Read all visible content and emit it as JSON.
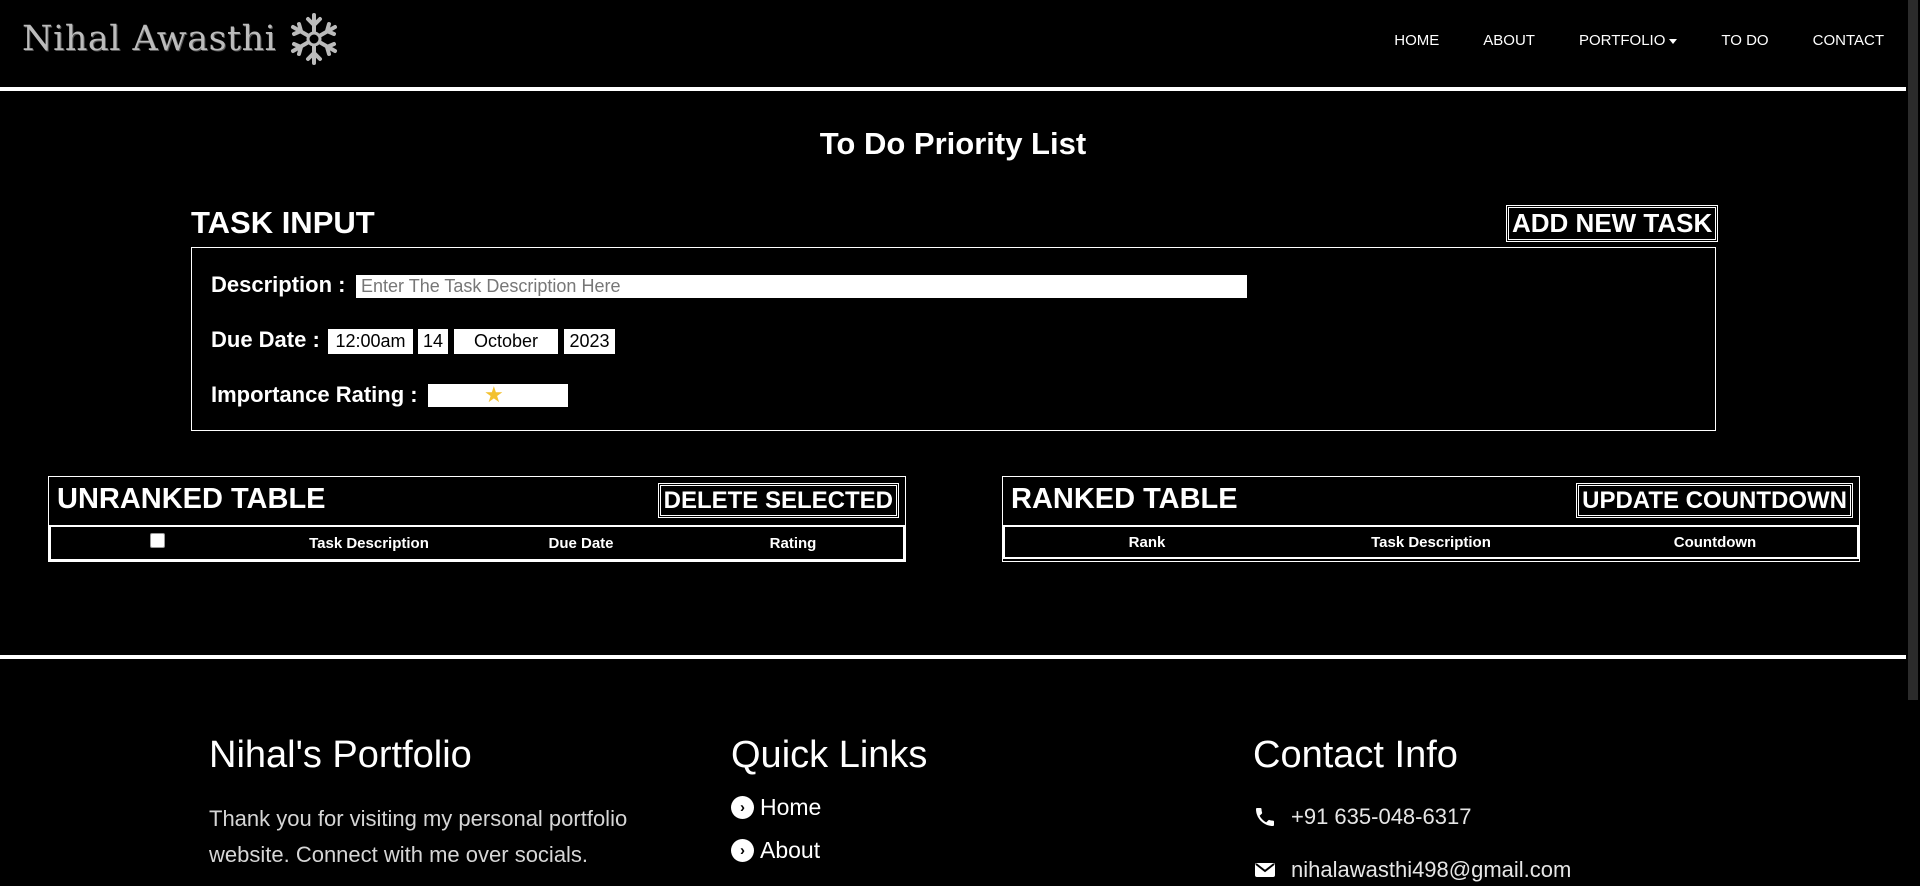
{
  "brand": {
    "name": "Nihal Awasthi"
  },
  "nav": [
    {
      "label": "HOME"
    },
    {
      "label": "ABOUT"
    },
    {
      "label": "PORTFOLIO"
    },
    {
      "label": "TO DO"
    },
    {
      "label": "CONTACT"
    }
  ],
  "page_title": "To Do Priority List",
  "task_input": {
    "title": "TASK INPUT",
    "add_button": "ADD NEW TASK",
    "description_label": "Description :",
    "description_placeholder": "Enter The Task Description Here",
    "due_label": "Due Date :",
    "due_time": "12:00am",
    "due_day": "14",
    "due_month": "October",
    "due_year": "2023",
    "importance_label": "Importance Rating :",
    "importance_stars": 1,
    "star_color": "#f3c12e"
  },
  "unranked": {
    "title": "UNRANKED TABLE",
    "button": "DELETE SELECTED",
    "columns": [
      "Task Description",
      "Due Date",
      "Rating"
    ]
  },
  "ranked": {
    "title": "RANKED TABLE",
    "button": "UPDATE COUNTDOWN",
    "columns": [
      "Rank",
      "Task Description",
      "Countdown"
    ]
  },
  "footer": {
    "portfolio": {
      "title": "Nihal's Portfolio",
      "text": "Thank you for visiting my personal portfolio website. Connect with me over socials."
    },
    "quick_links": {
      "title": "Quick Links",
      "items": [
        "Home",
        "About"
      ]
    },
    "contact": {
      "title": "Contact Info",
      "phone": "+91 635-048-6317",
      "email": "nihalawasthi498@gmail.com"
    }
  }
}
